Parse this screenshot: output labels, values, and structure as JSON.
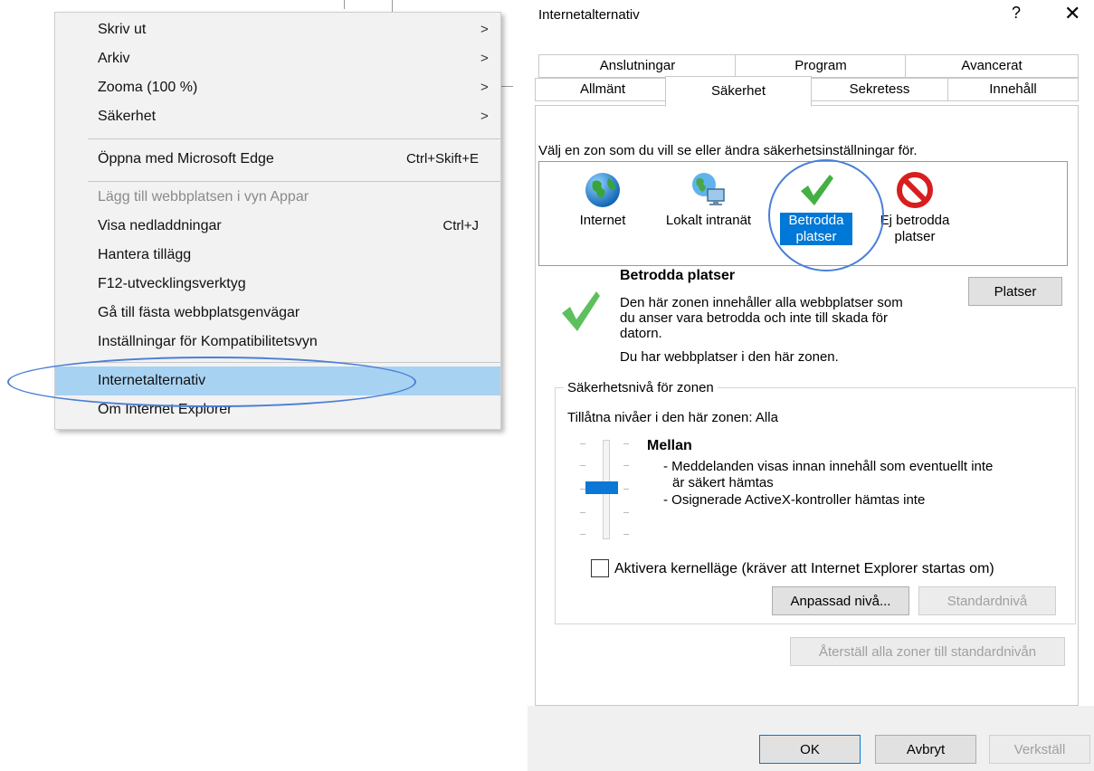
{
  "menu": {
    "items": [
      {
        "label": "Skriv ut",
        "submenu": true
      },
      {
        "label": "Arkiv",
        "submenu": true
      },
      {
        "label": "Zooma (100 %)",
        "submenu": true
      },
      {
        "label": "Säkerhet",
        "submenu": true
      },
      {
        "label": "Öppna med Microsoft Edge",
        "shortcut": "Ctrl+Skift+E"
      },
      {
        "label": "Lägg till webbplatsen i vyn Appar",
        "disabled": true
      },
      {
        "label": "Visa nedladdningar",
        "shortcut": "Ctrl+J"
      },
      {
        "label": "Hantera tillägg"
      },
      {
        "label": "F12-utvecklingsverktyg"
      },
      {
        "label": "Gå till fästa webbplatsgenvägar"
      },
      {
        "label": "Inställningar för Kompatibilitetsvyn"
      },
      {
        "label": "Internetalternativ",
        "highlighted": true
      },
      {
        "label": "Om Internet Explorer"
      }
    ],
    "arrow": ">"
  },
  "dialog": {
    "title": "Internetalternativ",
    "help": "?",
    "close": "✕",
    "tabs_row1": [
      "Anslutningar",
      "Program",
      "Avancerat"
    ],
    "tabs_row2": [
      "Allmänt",
      "Säkerhet",
      "Sekretess",
      "Innehåll"
    ],
    "active_tab": "Säkerhet",
    "zone_prompt": "Välj en zon som du vill se eller ändra säkerhetsinställningar för.",
    "zones": [
      {
        "line1": "Internet",
        "line2": "",
        "icon": "globe-icon"
      },
      {
        "line1": "Lokalt intranät",
        "line2": "",
        "icon": "computer-globe-icon"
      },
      {
        "line1": "Betrodda",
        "line2": "platser",
        "icon": "checkmark-icon",
        "selected": true
      },
      {
        "line1": "Ej betrodda",
        "line2": "platser",
        "icon": "blocked-icon"
      }
    ],
    "zone_title": "Betrodda platser",
    "zone_desc_lines": [
      "Den här zonen innehåller alla webbplatser som",
      "du anser vara betrodda och inte till skada för",
      "datorn.",
      "Du har webbplatser i den här zonen."
    ],
    "sites_button": "Platser",
    "group_title": "Säkerhetsnivå för zonen",
    "allowed_levels": "Tillåtna nivåer i den här zonen: Alla",
    "level_name": "Mellan",
    "level_lines": [
      "- Meddelanden visas innan innehåll som eventuellt inte",
      "är säkert hämtas",
      "- Osignerade ActiveX-kontroller hämtas inte"
    ],
    "kernel_checkbox": "Aktivera kernelläge (kräver att Internet Explorer startas om)",
    "custom_level_button": "Anpassad nivå...",
    "default_level_button": "Standardnivå",
    "reset_all_button": "Återställ alla zoner till standardnivån",
    "ok_button": "OK",
    "cancel_button": "Avbryt",
    "apply_button": "Verkställ"
  },
  "colors": {
    "highlight": "#a8d2f2",
    "selection": "#0078d7",
    "annotation": "#4a7fd6"
  }
}
